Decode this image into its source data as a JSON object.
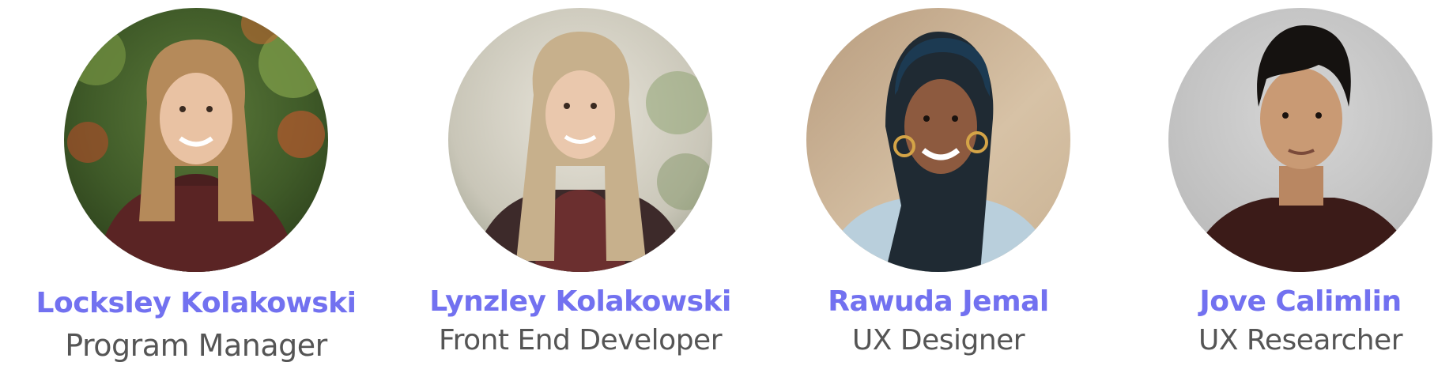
{
  "theme": {
    "name_color": "#7271f0",
    "role_color": "#555555",
    "background": "#ffffff"
  },
  "team": {
    "members": [
      {
        "name": "Locksley Kolakowski",
        "role": "Program Manager",
        "photo": "portrait-photo-outdoor-foliage"
      },
      {
        "name": "Lynzley Kolakowski",
        "role": "Front End Developer",
        "photo": "portrait-photo-outdoor-light"
      },
      {
        "name": "Rawuda Jemal",
        "role": "UX Designer",
        "photo": "portrait-photo-indoor-warm"
      },
      {
        "name": "Jove Calimlin",
        "role": "UX Researcher",
        "photo": "portrait-photo-grey-backdrop"
      }
    ]
  }
}
